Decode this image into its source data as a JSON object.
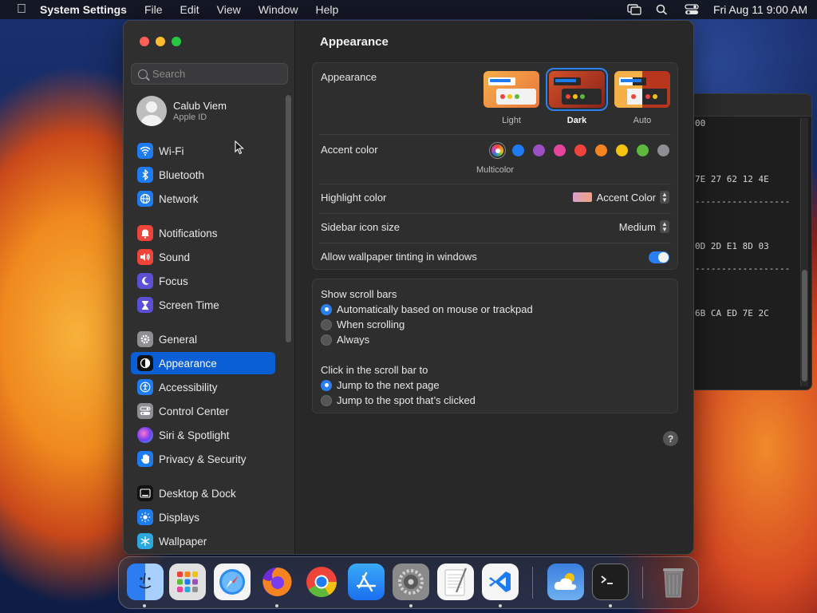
{
  "menubar": {
    "app_name": "System Settings",
    "items": [
      "File",
      "Edit",
      "View",
      "Window",
      "Help"
    ],
    "clock": "Fri Aug 11  9:00 AM"
  },
  "terminal": {
    "lines": [
      "00",
      "7E 27 62 12 4E",
      "------------------",
      "0D 2D E1 8D 03",
      "------------------",
      "6B CA ED 7E 2C"
    ]
  },
  "sidebar": {
    "search_placeholder": "Search",
    "profile": {
      "name": "Calub Viem",
      "subtitle": "Apple ID"
    },
    "items": [
      {
        "label": "Wi-Fi",
        "icon": "wifi-icon",
        "color": "#1e7cf2"
      },
      {
        "label": "Bluetooth",
        "icon": "bluetooth-icon",
        "color": "#1e7cf2"
      },
      {
        "label": "Network",
        "icon": "globe-icon",
        "color": "#1e7cf2"
      },
      {
        "label": "Notifications",
        "icon": "bell-icon",
        "color": "#f0433a"
      },
      {
        "label": "Sound",
        "icon": "speaker-icon",
        "color": "#f0433a"
      },
      {
        "label": "Focus",
        "icon": "moon-icon",
        "color": "#5b4fd6"
      },
      {
        "label": "Screen Time",
        "icon": "hourglass-icon",
        "color": "#5b4fd6"
      },
      {
        "label": "General",
        "icon": "gear-icon",
        "color": "#8e8e93"
      },
      {
        "label": "Appearance",
        "icon": "appearance-icon",
        "color": "#111111"
      },
      {
        "label": "Accessibility",
        "icon": "accessibility-icon",
        "color": "#1e7cf2"
      },
      {
        "label": "Control Center",
        "icon": "control-center-icon",
        "color": "#8e8e93"
      },
      {
        "label": "Siri & Spotlight",
        "icon": "siri-icon",
        "color": "#c94bd6"
      },
      {
        "label": "Privacy & Security",
        "icon": "hand-icon",
        "color": "#1e7cf2"
      },
      {
        "label": "Desktop & Dock",
        "icon": "dock-icon",
        "color": "#111111"
      },
      {
        "label": "Displays",
        "icon": "sun-icon",
        "color": "#1e7cf2"
      },
      {
        "label": "Wallpaper",
        "icon": "snowflake-icon",
        "color": "#2aa8e0"
      }
    ],
    "active": "Appearance"
  },
  "main": {
    "title": "Appearance",
    "appearance": {
      "label": "Appearance",
      "options": [
        {
          "label": "Light",
          "selected": false
        },
        {
          "label": "Dark",
          "selected": true
        },
        {
          "label": "Auto",
          "selected": false
        }
      ]
    },
    "accent": {
      "label": "Accent color",
      "colors": [
        "multicolor",
        "#1e7cf2",
        "#9b4fc2",
        "#e6449a",
        "#f0433a",
        "#f5831f",
        "#f2c20e",
        "#5fb83e",
        "#8e8e93"
      ],
      "selected_label": "Multicolor"
    },
    "highlight": {
      "label": "Highlight color",
      "value": "Accent Color"
    },
    "sidebar_icon_size": {
      "label": "Sidebar icon size",
      "value": "Medium"
    },
    "wallpaper_tinting": {
      "label": "Allow wallpaper tinting in windows",
      "on": true
    },
    "scroll_bars": {
      "label": "Show scroll bars",
      "options": [
        "Automatically based on mouse or trackpad",
        "When scrolling",
        "Always"
      ],
      "selected": 0
    },
    "click_scroll": {
      "label": "Click in the scroll bar to",
      "options": [
        "Jump to the next page",
        "Jump to the spot that’s clicked"
      ],
      "selected": 0
    },
    "help": "?"
  },
  "dock": {
    "apps": [
      {
        "name": "finder",
        "color": "#3d8ff5"
      },
      {
        "name": "launchpad",
        "color": "#d9d9d9"
      },
      {
        "name": "safari",
        "color": "#e8f2ff"
      },
      {
        "name": "firefox",
        "color": "#6e2bd9"
      },
      {
        "name": "chrome",
        "color": "#f3f3f3"
      },
      {
        "name": "app-store",
        "color": "#1a8cf0"
      },
      {
        "name": "system-settings",
        "color": "#7a7a7a"
      },
      {
        "name": "textedit",
        "color": "#f2f2f2"
      },
      {
        "name": "vscode",
        "color": "#f4f4f4"
      },
      {
        "name": "weather",
        "color": "#3f88e8"
      },
      {
        "name": "terminal",
        "color": "#222222"
      },
      {
        "name": "trash",
        "color": "#6b6b6b"
      }
    ]
  }
}
